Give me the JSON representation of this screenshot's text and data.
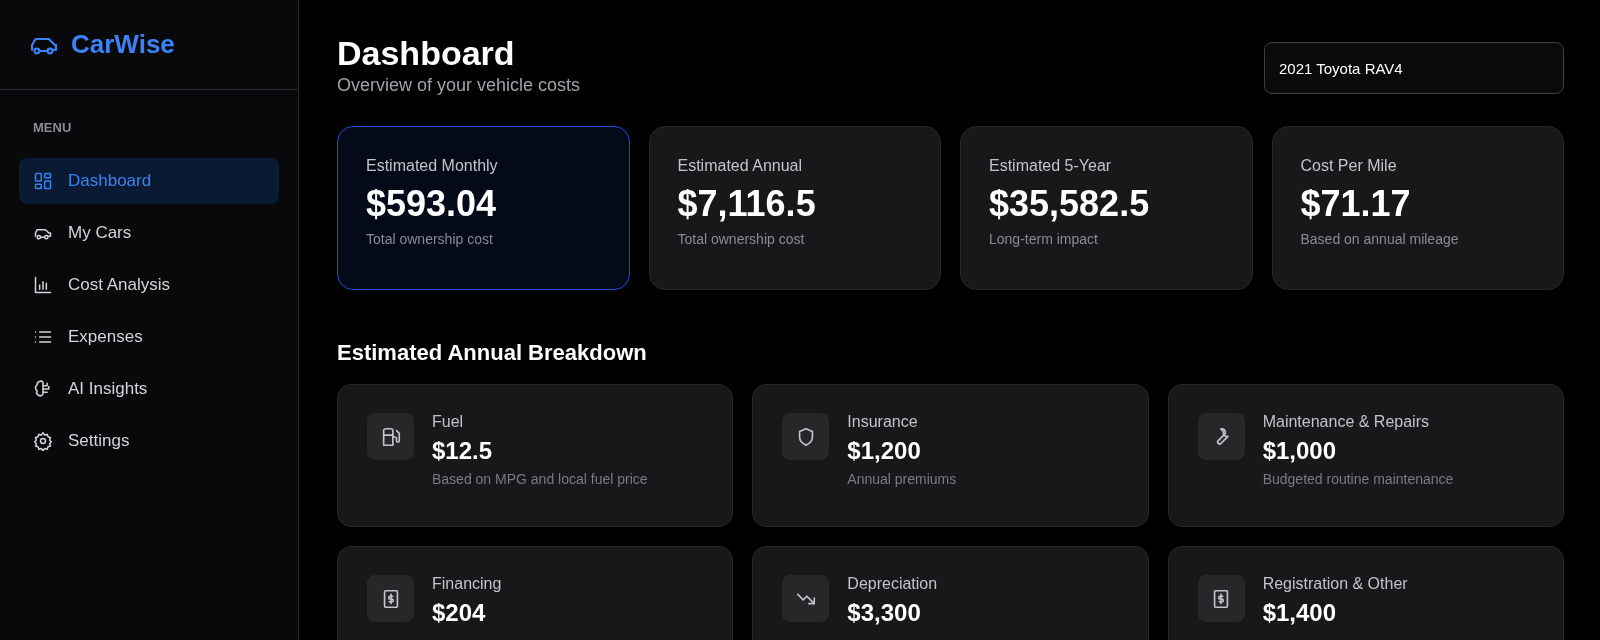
{
  "brand": {
    "name": "CarWise"
  },
  "sidebar": {
    "section_label": "MENU",
    "items": [
      {
        "label": "Dashboard",
        "kind": "grid",
        "selected": true
      },
      {
        "label": "My Cars",
        "kind": "car",
        "selected": false
      },
      {
        "label": "Cost Analysis",
        "kind": "bars",
        "selected": false
      },
      {
        "label": "Expenses",
        "kind": "list",
        "selected": false
      },
      {
        "label": "AI Insights",
        "kind": "brain",
        "selected": false
      },
      {
        "label": "Settings",
        "kind": "gear",
        "selected": false
      }
    ]
  },
  "header": {
    "title": "Dashboard",
    "subtitle": "Overview of your vehicle costs",
    "vehicle_select": {
      "value": "2021 Toyota RAV4"
    }
  },
  "summary_cards": [
    {
      "label": "Estimated Monthly",
      "value": "$593.04",
      "note": "Total ownership cost",
      "selected": true
    },
    {
      "label": "Estimated Annual",
      "value": "$7,116.5",
      "note": "Total ownership cost",
      "selected": false
    },
    {
      "label": "Estimated 5-Year",
      "value": "$35,582.5",
      "note": "Long-term impact",
      "selected": false
    },
    {
      "label": "Cost Per Mile",
      "value": "$71.17",
      "note": "Based on annual mileage",
      "selected": false
    }
  ],
  "breakdown": {
    "title": "Estimated Annual Breakdown",
    "items": [
      {
        "kind": "fuel",
        "label": "Fuel",
        "value": "$12.5",
        "note": "Based on MPG and local fuel price"
      },
      {
        "kind": "shield",
        "label": "Insurance",
        "value": "$1,200",
        "note": "Annual premiums"
      },
      {
        "kind": "wrench",
        "label": "Maintenance & Repairs",
        "value": "$1,000",
        "note": "Budgeted routine maintenance"
      },
      {
        "kind": "dollar",
        "label": "Financing",
        "value": "$204"
      },
      {
        "kind": "trend-down",
        "label": "Depreciation",
        "value": "$3,300"
      },
      {
        "kind": "dollar",
        "label": "Registration & Other",
        "value": "$1,400"
      }
    ]
  }
}
